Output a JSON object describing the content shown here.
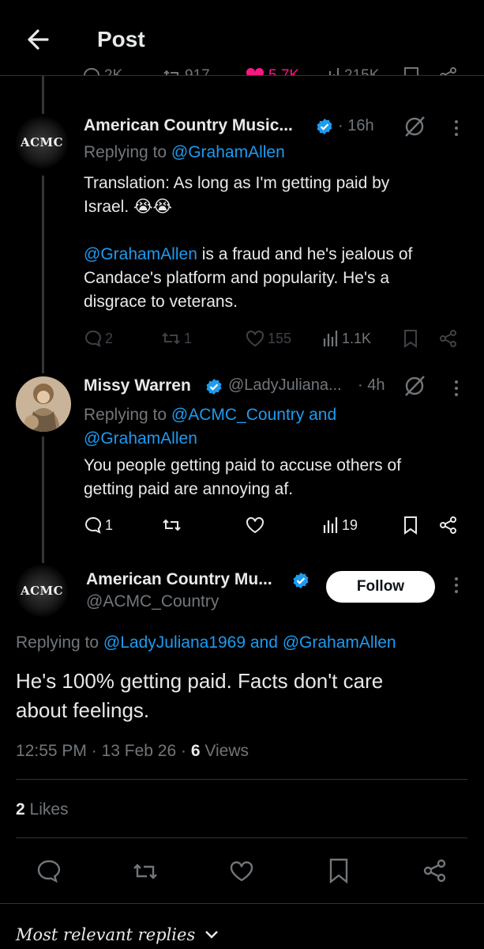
{
  "header": {
    "title": "Post"
  },
  "parent_actions": {
    "replies": "2K",
    "retweets": "917",
    "likes": "5.7K",
    "views": "215K"
  },
  "tweets": [
    {
      "avatar_text": "ACMC",
      "name": "American Country Music...",
      "time": "· 16h",
      "replying_prefix": "Replying to",
      "replying_handles": "@GrahamAllen",
      "text_line1": "Translation: As long as I'm getting paid by",
      "text_line2": "Israel. 😭😭",
      "mention": "@GrahamAllen",
      "text_line3_rest": " is a fraud and he's jealous of",
      "text_line4": "Candace's platform and popularity. He's a",
      "text_line5": "disgrace to veterans.",
      "replies": "2",
      "retweets": "1",
      "likes": "155",
      "views": "1.1K"
    },
    {
      "name": "Missy Warren",
      "handle": "@LadyJuliana...",
      "time": "· 4h",
      "replying_prefix": "Replying to",
      "replying_line1": "@ACMC_Country and",
      "replying_line2": "@GrahamAllen",
      "text_line1": "You people getting paid to accuse others of",
      "text_line2": "getting paid are annoying af.",
      "replies": "1",
      "views": "19"
    }
  ],
  "main": {
    "avatar_text": "ACMC",
    "name": "American Country Mu...",
    "handle": "@ACMC_Country",
    "follow_label": "Follow",
    "replying_prefix": "Replying to",
    "replying_handles": "@LadyJuliana1969 and @GrahamAllen",
    "text_line1": "He's 100% getting paid. Facts don't care",
    "text_line2": "about feelings.",
    "time": "12:55 PM",
    "date": "13 Feb 26",
    "views_count": "6",
    "views_label": "Views",
    "likes_count": "2",
    "likes_label": "Likes"
  },
  "footer": {
    "replies_sort": "Most relevant replies"
  },
  "colors": {
    "accent": "#1d9bf0",
    "like": "#f91880",
    "muted": "#71767b",
    "text": "#e7e9ea",
    "bg": "#000000"
  }
}
